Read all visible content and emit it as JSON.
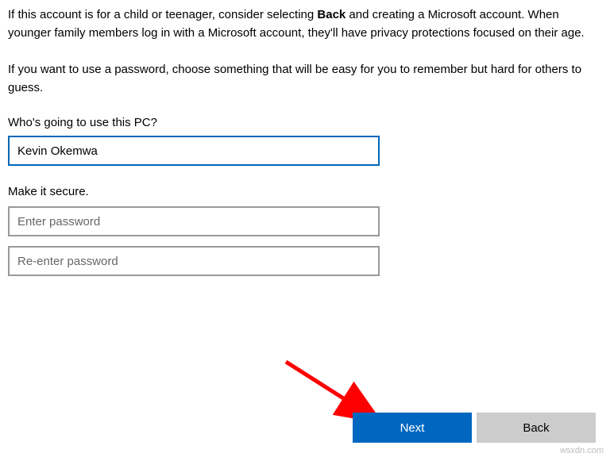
{
  "intro": {
    "p1_a": "If this account is for a child or teenager, consider selecting ",
    "p1_bold": "Back",
    "p1_b": " and creating a Microsoft account. When younger family members log in with a Microsoft account, they'll have privacy protections focused on their age.",
    "p2": "If you want to use a password, choose something that will be easy for you to remember but hard for others to guess."
  },
  "labels": {
    "who": "Who's going to use this PC?",
    "secure": "Make it secure."
  },
  "fields": {
    "username_value": "Kevin Okemwa",
    "password_placeholder": "Enter password",
    "password2_placeholder": "Re-enter password"
  },
  "buttons": {
    "next": "Next",
    "back": "Back"
  },
  "watermark": "wsxdn.com"
}
